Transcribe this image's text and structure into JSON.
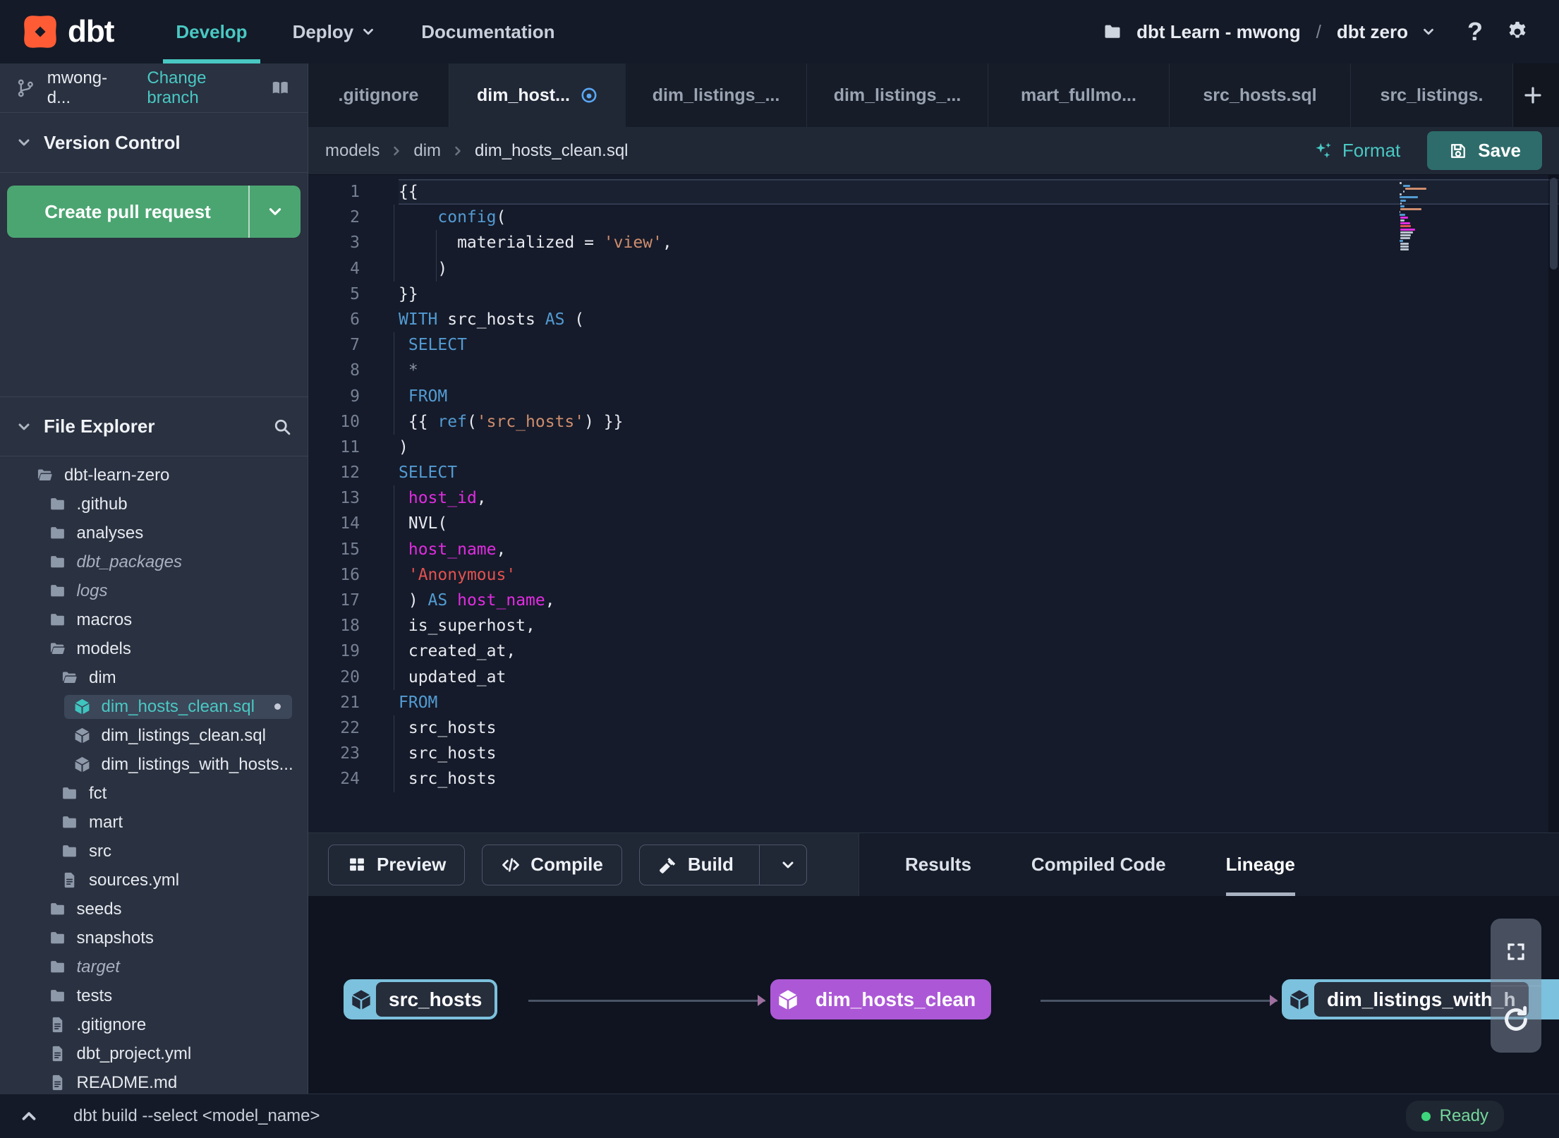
{
  "nav": {
    "logo_text": "dbt",
    "items": [
      {
        "label": "Develop",
        "active": true
      },
      {
        "label": "Deploy",
        "chevron": true
      },
      {
        "label": "Documentation"
      }
    ],
    "project": "dbt Learn - mwong",
    "separator": "/",
    "environment": "dbt zero",
    "help_label": "?"
  },
  "sidebar": {
    "branch": {
      "name": "mwong-d...",
      "action": "Change branch"
    },
    "version_control": {
      "title": "Version Control",
      "create_pr": "Create pull request"
    },
    "file_explorer": {
      "title": "File Explorer"
    },
    "tree": [
      {
        "name": "dbt-learn-zero",
        "icon": "folder-open",
        "depth": 0
      },
      {
        "name": ".github",
        "icon": "folder",
        "depth": 1
      },
      {
        "name": "analyses",
        "icon": "folder",
        "depth": 1
      },
      {
        "name": "dbt_packages",
        "icon": "folder",
        "depth": 1,
        "italic": true
      },
      {
        "name": "logs",
        "icon": "folder",
        "depth": 1,
        "italic": true
      },
      {
        "name": "macros",
        "icon": "folder",
        "depth": 1
      },
      {
        "name": "models",
        "icon": "folder-open",
        "depth": 1
      },
      {
        "name": "dim",
        "icon": "folder-open",
        "depth": 2
      },
      {
        "name": "dim_hosts_clean.sql",
        "icon": "model",
        "depth": 3,
        "selected": true,
        "modified": true
      },
      {
        "name": "dim_listings_clean.sql",
        "icon": "model",
        "depth": 3
      },
      {
        "name": "dim_listings_with_hosts...",
        "icon": "model",
        "depth": 3
      },
      {
        "name": "fct",
        "icon": "folder",
        "depth": 2
      },
      {
        "name": "mart",
        "icon": "folder",
        "depth": 2
      },
      {
        "name": "src",
        "icon": "folder",
        "depth": 2
      },
      {
        "name": "sources.yml",
        "icon": "file",
        "depth": 2
      },
      {
        "name": "seeds",
        "icon": "folder",
        "depth": 1
      },
      {
        "name": "snapshots",
        "icon": "folder",
        "depth": 1
      },
      {
        "name": "target",
        "icon": "folder",
        "depth": 1,
        "italic": true
      },
      {
        "name": "tests",
        "icon": "folder",
        "depth": 1
      },
      {
        "name": ".gitignore",
        "icon": "file",
        "depth": 1
      },
      {
        "name": "dbt_project.yml",
        "icon": "file",
        "depth": 1
      },
      {
        "name": "README.md",
        "icon": "file",
        "depth": 1
      }
    ]
  },
  "tabs": {
    "items": [
      {
        "label": ".gitignore"
      },
      {
        "label": "dim_host...",
        "active": true,
        "modified": true
      },
      {
        "label": "dim_listings_..."
      },
      {
        "label": "dim_listings_..."
      },
      {
        "label": "mart_fullmo..."
      },
      {
        "label": "src_hosts.sql"
      },
      {
        "label": "src_listings."
      }
    ],
    "add": "+"
  },
  "breadcrumb": {
    "path": [
      "models",
      "dim",
      "dim_hosts_clean.sql"
    ]
  },
  "editor_actions": {
    "format": "Format",
    "save": "Save"
  },
  "editor": {
    "lines": [
      {
        "cur": true,
        "t": [
          [
            "pun",
            "{{"
          ]
        ]
      },
      {
        "g": [
          0
        ],
        "t": [
          [
            "pln",
            "    "
          ],
          [
            "kw",
            "config"
          ],
          [
            "pun",
            "("
          ]
        ]
      },
      {
        "g": [
          0,
          4
        ],
        "t": [
          [
            "pln",
            "      materialized = "
          ],
          [
            "str",
            "'view'"
          ],
          [
            "pun",
            ","
          ]
        ]
      },
      {
        "g": [
          0,
          4
        ],
        "t": [
          [
            "pln",
            "    )"
          ]
        ]
      },
      {
        "t": [
          [
            "pun",
            "}}"
          ]
        ]
      },
      {
        "t": [
          [
            "kw",
            "WITH"
          ],
          [
            "pln",
            " src_hosts "
          ],
          [
            "kw",
            "AS"
          ],
          [
            "pln",
            " ("
          ]
        ]
      },
      {
        "g": [
          0
        ],
        "t": [
          [
            "pln",
            " "
          ],
          [
            "kw",
            "SELECT"
          ]
        ]
      },
      {
        "g": [
          0
        ],
        "t": [
          [
            "pln",
            " "
          ],
          [
            "dim",
            "*"
          ]
        ]
      },
      {
        "g": [
          0
        ],
        "t": [
          [
            "pln",
            " "
          ],
          [
            "kw",
            "FROM"
          ]
        ]
      },
      {
        "g": [
          0
        ],
        "t": [
          [
            "pln",
            " {{ "
          ],
          [
            "kw",
            "ref"
          ],
          [
            "pun",
            "("
          ],
          [
            "str",
            "'src_hosts'"
          ],
          [
            "pun",
            ")"
          ],
          [
            "pln",
            " }}"
          ]
        ]
      },
      {
        "t": [
          [
            "pun",
            ")"
          ]
        ]
      },
      {
        "t": [
          [
            "kw",
            "SELECT"
          ]
        ]
      },
      {
        "g": [
          0
        ],
        "t": [
          [
            "pln",
            " "
          ],
          [
            "mag",
            "host_id"
          ],
          [
            "pun",
            ","
          ]
        ]
      },
      {
        "g": [
          0
        ],
        "t": [
          [
            "pln",
            " NVL("
          ]
        ]
      },
      {
        "g": [
          0
        ],
        "t": [
          [
            "pln",
            " "
          ],
          [
            "mag",
            "host_name"
          ],
          [
            "pun",
            ","
          ]
        ]
      },
      {
        "g": [
          0
        ],
        "t": [
          [
            "pln",
            " "
          ],
          [
            "red",
            "'Anonymous'"
          ]
        ]
      },
      {
        "g": [
          0
        ],
        "t": [
          [
            "pln",
            " ) "
          ],
          [
            "kw",
            "AS"
          ],
          [
            "pln",
            " "
          ],
          [
            "mag",
            "host_name"
          ],
          [
            "pun",
            ","
          ]
        ]
      },
      {
        "g": [
          0
        ],
        "t": [
          [
            "pln",
            " is_superhost,"
          ]
        ]
      },
      {
        "g": [
          0
        ],
        "t": [
          [
            "pln",
            " created_at,"
          ]
        ]
      },
      {
        "g": [
          0
        ],
        "t": [
          [
            "pln",
            " updated_at"
          ]
        ]
      },
      {
        "t": [
          [
            "kw",
            "FROM"
          ]
        ]
      },
      {
        "g": [
          0
        ],
        "t": [
          [
            "pln",
            " src_hosts"
          ]
        ]
      },
      {
        "g": [
          0
        ],
        "t": [
          [
            "pln",
            " src_hosts"
          ]
        ]
      },
      {
        "g": [
          0
        ],
        "t": [
          [
            "pln",
            " src_hosts"
          ]
        ]
      }
    ]
  },
  "bottom_panel": {
    "buttons": [
      {
        "label": "Preview",
        "icon": "grid"
      },
      {
        "label": "Compile",
        "icon": "code"
      },
      {
        "label": "Build",
        "icon": "hammer",
        "split": true
      }
    ],
    "tabs": [
      {
        "label": "Results"
      },
      {
        "label": "Compiled Code"
      },
      {
        "label": "Lineage",
        "active": true
      }
    ]
  },
  "lineage": {
    "nodes": [
      {
        "label": "src_hosts",
        "color": "blue"
      },
      {
        "label": "dim_hosts_clean",
        "color": "purple"
      },
      {
        "label": "dim_listings_with_h",
        "color": "blue",
        "clipped": true
      }
    ]
  },
  "status_bar": {
    "command": "dbt build --select <model_name>",
    "status": "Ready"
  },
  "colors": {
    "accent_teal": "#49c8c3",
    "create_pr_green": "#4ba571",
    "save_teal": "#2d6c6a",
    "tab_modified_blue": "#5aa7f5",
    "lineage_blue": "#7cc1dd",
    "lineage_purple": "#ac58d6",
    "status_ready_green": "#3ed47c",
    "logo_orange": "#ff5c35",
    "code_keyword": "#539bd3",
    "code_string": "#cf8d6e",
    "code_identifier_magenta": "#e12ce1",
    "code_string_red": "#e25250"
  }
}
